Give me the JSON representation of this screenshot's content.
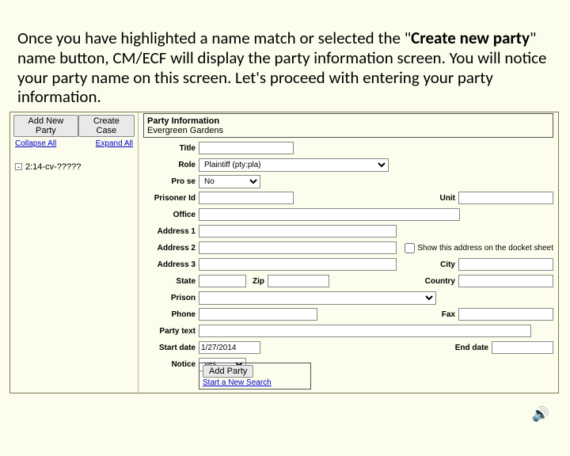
{
  "instructions": {
    "pre": "Once you have highlighted a name match or selected the \"",
    "bold": "Create new party",
    "post": "\" name button, CM/ECF will display the party information screen.  You will notice your party name on this screen.  Let's proceed with entering your party information."
  },
  "left": {
    "add_new_party": "Add New Party",
    "create_case": "Create Case",
    "collapse_all": "Collapse All",
    "expand_all": "Expand All",
    "tree_toggle": "-",
    "case_number": "2:14-cv-?????"
  },
  "party_info": {
    "header": "Party Information",
    "party_name": "Evergreen Gardens"
  },
  "labels": {
    "title": "Title",
    "role": "Role",
    "prose": "Pro se",
    "prisoner_id": "Prisoner Id",
    "unit": "Unit",
    "office": "Office",
    "address1": "Address 1",
    "address2": "Address 2",
    "address3": "Address 3",
    "city": "City",
    "state": "State",
    "zip": "Zip",
    "country": "Country",
    "prison": "Prison",
    "phone": "Phone",
    "fax": "Fax",
    "party_text": "Party text",
    "start_date": "Start date",
    "end_date": "End date",
    "notice": "Notice",
    "docket_checkbox": "Show this address on the docket sheet"
  },
  "values": {
    "title": "",
    "role": "Plaintiff (pty:pla)",
    "prose": "No",
    "prisoner_id": "",
    "unit": "",
    "office": "",
    "address1": "",
    "address2": "",
    "address3": "",
    "city": "",
    "state": "",
    "zip": "",
    "country": "",
    "prison": "",
    "phone": "",
    "fax": "",
    "party_text": "",
    "start_date": "1/27/2014",
    "end_date": "",
    "notice": "yes"
  },
  "actions": {
    "add_party": "Add Party",
    "start_new_search": "Start a New Search"
  },
  "speaker_icon": "🔊"
}
